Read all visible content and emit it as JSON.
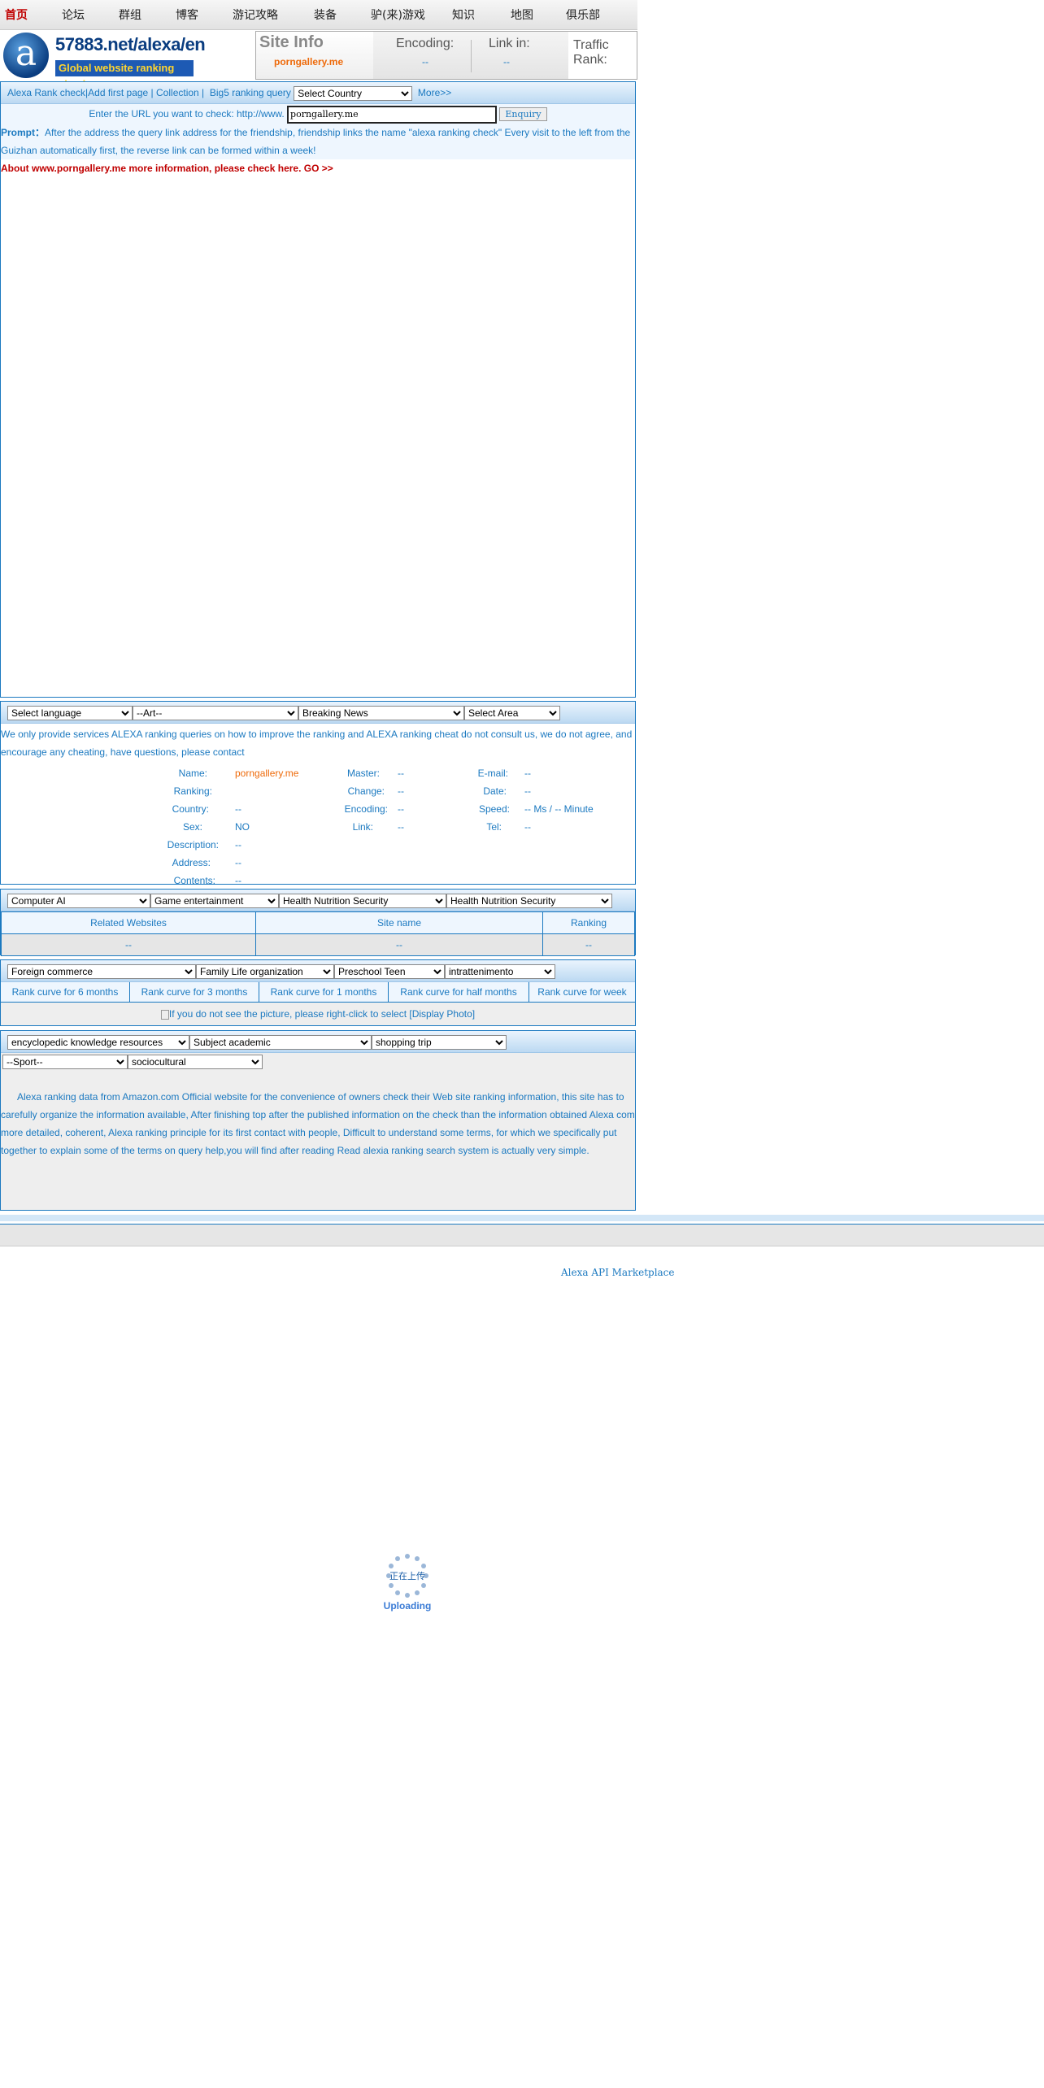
{
  "nav": [
    "首页",
    "论坛",
    "群组",
    "博客",
    "游记攻略",
    "装备",
    "驴(来)游戏",
    "知识",
    "地图",
    "俱乐部"
  ],
  "logo": {
    "letter": "a",
    "title": "57883.net/alexa/en",
    "subtitle": "Global website ranking check"
  },
  "siteinfo": {
    "title": "Site Info",
    "site": "porngallery.me",
    "encoding_label": "Encoding:",
    "encoding_value": "--",
    "link_label": "Link in:",
    "link_value": "--",
    "traffic_label": "Traffic Rank:"
  },
  "toolbar": {
    "rank_check": "Alexa Rank check",
    "add_first": "Add first page",
    "collection": "Collection",
    "big5": "Big5 ranking query",
    "country_select": "Select Country",
    "more": "More>>"
  },
  "query": {
    "label": "Enter the URL you want to check: http://www.",
    "value": "porngallery.me",
    "button": "Enquiry"
  },
  "prompt": {
    "title": "Prompt：",
    "text": "After the address the query link address for the friendship, friendship links the name \"alexa ranking check\" Every visit to the left from the Guizhan automatically first, the reverse link can be formed within a week!"
  },
  "about": "About www.porngallery.me more information, please check here. GO >>",
  "filters1": [
    "Select language",
    "--Art--",
    "Breaking News",
    "Select Area"
  ],
  "notice": "We only provide services ALEXA ranking queries on how to improve the ranking and ALEXA ranking cheat do not consult us, we do not agree, and encourage any cheating, have questions, please contact",
  "details": {
    "name_label": "Name:",
    "name": "porngallery.me",
    "master_label": "Master:",
    "master": "--",
    "email_label": "E-mail:",
    "email": "--",
    "ranking_label": "Ranking:",
    "ranking": "",
    "change_label": "Change:",
    "change": "--",
    "date_label": "Date:",
    "date": "--",
    "country_label": "Country:",
    "country": "--",
    "encoding_label": "Encoding:",
    "encoding": "--",
    "speed_label": "Speed:",
    "speed": "-- Ms / -- Minute",
    "sex_label": "Sex:",
    "sex": "NO",
    "link_label": "Link:",
    "link": "--",
    "tel_label": "Tel:",
    "tel": "--",
    "description_label": "Description:",
    "description": "--",
    "address_label": "Address:",
    "address": "--",
    "contents_label": "Contents:",
    "contents": "--"
  },
  "filters2": [
    "Computer AI",
    "Game entertainment",
    "Health Nutrition Security",
    "Health Nutrition Security"
  ],
  "related": {
    "headers": [
      "Related Websites",
      "Site name",
      "Ranking"
    ],
    "row": [
      "--",
      "--",
      "--"
    ]
  },
  "filters3": [
    "Foreign commerce",
    "Family Life organization",
    "Preschool Teen",
    "intrattenimento"
  ],
  "curves": [
    "Rank curve for 6 months",
    "Rank curve for 3 months",
    "Rank curve for 1 months",
    "Rank curve for half months",
    "Rank curve for week"
  ],
  "photo_text": "If you do not see the picture, please right-click to select [Display Photo]",
  "filters4": [
    "encyclopedic knowledge resources",
    "Subject academic",
    "shopping trip",
    "--Sport--",
    "sociocultural"
  ],
  "description_text": "Alexa ranking data from Amazon.com Official website for the convenience of owners check their Web site ranking information, this site has to carefully organize the information available, After finishing top after the published information on the check than the information obtained Alexa com more detailed, coherent, Alexa ranking principle for its first contact with people, Difficult to understand some terms, for which we specifically put together to explain some of the terms on query help,you will find after reading Read alexia ranking search system  is actually very simple.",
  "api_link": "Alexa API Marketplace",
  "uploading": {
    "cn": "正在上传",
    "en": "Uploading"
  }
}
